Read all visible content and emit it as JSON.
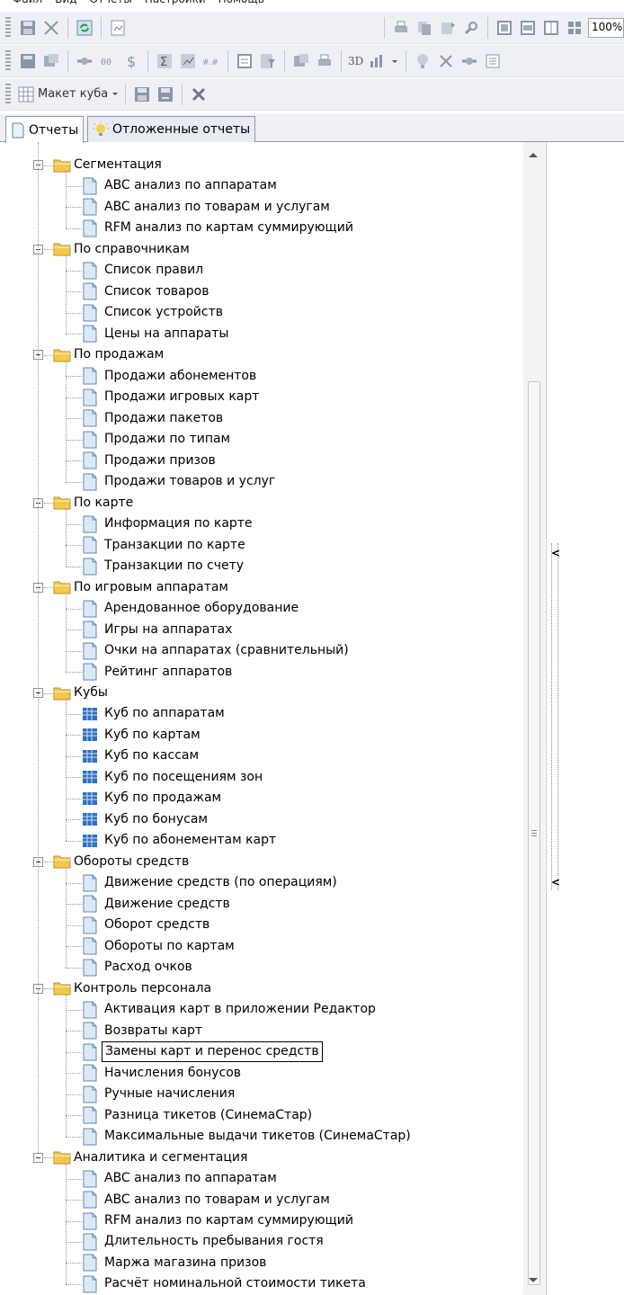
{
  "menubar": [
    "Файл",
    "Вид",
    "Отчеты",
    "Настройки",
    "Помощь"
  ],
  "toolbar": {
    "zoom": "100%",
    "cube_layout_label": "Макет куба",
    "threed_label": "3D"
  },
  "tabs": [
    {
      "label": "Отчеты",
      "icon": "document-icon",
      "active": true
    },
    {
      "label": "Отложенные отчеты",
      "icon": "lightbulb-icon",
      "active": false
    }
  ],
  "tree": [
    {
      "folder": "Сегментация",
      "items": [
        {
          "label": "ABC анализ по аппаратам",
          "icon": "report"
        },
        {
          "label": "ABC анализ по товарам и услугам",
          "icon": "report"
        },
        {
          "label": "RFM анализ по картам суммирующий",
          "icon": "report"
        }
      ]
    },
    {
      "folder": "По справочникам",
      "items": [
        {
          "label": "Список правил",
          "icon": "report"
        },
        {
          "label": "Список товаров",
          "icon": "report"
        },
        {
          "label": "Список устройств",
          "icon": "report"
        },
        {
          "label": "Цены на аппараты",
          "icon": "report"
        }
      ]
    },
    {
      "folder": "По продажам",
      "items": [
        {
          "label": "Продажи абонементов",
          "icon": "report"
        },
        {
          "label": "Продажи игровых карт",
          "icon": "report"
        },
        {
          "label": "Продажи пакетов",
          "icon": "report"
        },
        {
          "label": "Продажи по типам",
          "icon": "report"
        },
        {
          "label": "Продажи призов",
          "icon": "report"
        },
        {
          "label": "Продажи товаров и услуг",
          "icon": "report"
        }
      ]
    },
    {
      "folder": "По карте",
      "items": [
        {
          "label": "Информация по карте",
          "icon": "report"
        },
        {
          "label": "Транзакции по карте",
          "icon": "report"
        },
        {
          "label": "Транзакции по счету",
          "icon": "report"
        }
      ]
    },
    {
      "folder": "По игровым аппаратам",
      "items": [
        {
          "label": "Арендованное оборудование",
          "icon": "report"
        },
        {
          "label": "Игры на аппаратах",
          "icon": "report"
        },
        {
          "label": "Очки на аппаратах (сравнительный)",
          "icon": "report"
        },
        {
          "label": "Рейтинг аппаратов",
          "icon": "report"
        }
      ]
    },
    {
      "folder": "Кубы",
      "items": [
        {
          "label": "Куб по аппаратам",
          "icon": "cube"
        },
        {
          "label": "Куб по картам",
          "icon": "cube"
        },
        {
          "label": "Куб по кассам",
          "icon": "cube"
        },
        {
          "label": "Куб по посещениям зон",
          "icon": "cube"
        },
        {
          "label": "Куб по продажам",
          "icon": "cube"
        },
        {
          "label": "Куб по бонусам",
          "icon": "cube"
        },
        {
          "label": "Куб по абонементам карт",
          "icon": "cube"
        }
      ]
    },
    {
      "folder": "Обороты средств",
      "items": [
        {
          "label": "Движение средств (по операциям)",
          "icon": "report"
        },
        {
          "label": "Движение средств",
          "icon": "report"
        },
        {
          "label": "Оборот средств",
          "icon": "report"
        },
        {
          "label": "Обороты по картам",
          "icon": "report"
        },
        {
          "label": "Расход очков",
          "icon": "report"
        }
      ]
    },
    {
      "folder": "Контроль персонала",
      "items": [
        {
          "label": "Активация карт в приложении Редактор",
          "icon": "report"
        },
        {
          "label": "Возвраты карт",
          "icon": "report"
        },
        {
          "label": "Замены карт и перенос средств",
          "icon": "report",
          "selected": true
        },
        {
          "label": "Начисления бонусов",
          "icon": "report"
        },
        {
          "label": "Ручные начисления",
          "icon": "report"
        },
        {
          "label": "Разница тикетов (СинемаСтар)",
          "icon": "report"
        },
        {
          "label": "Максимальные выдачи тикетов (СинемаСтар)",
          "icon": "report"
        }
      ]
    },
    {
      "folder": "Аналитика и сегментация",
      "items": [
        {
          "label": "ABC анализ по аппаратам",
          "icon": "report"
        },
        {
          "label": "ABC анализ по товарам и услугам",
          "icon": "report"
        },
        {
          "label": "RFM анализ по картам суммирующий",
          "icon": "report"
        },
        {
          "label": "Длительность пребывания гостя",
          "icon": "report"
        },
        {
          "label": "Маржа магазина призов",
          "icon": "report"
        },
        {
          "label": "Расчёт номинальной стоимости тикета",
          "icon": "report"
        }
      ]
    }
  ],
  "colors": {
    "folder": "#f2c94c",
    "report": "#dbe9f7",
    "cube": "#2f6fc0",
    "selection_border": "#000000"
  }
}
